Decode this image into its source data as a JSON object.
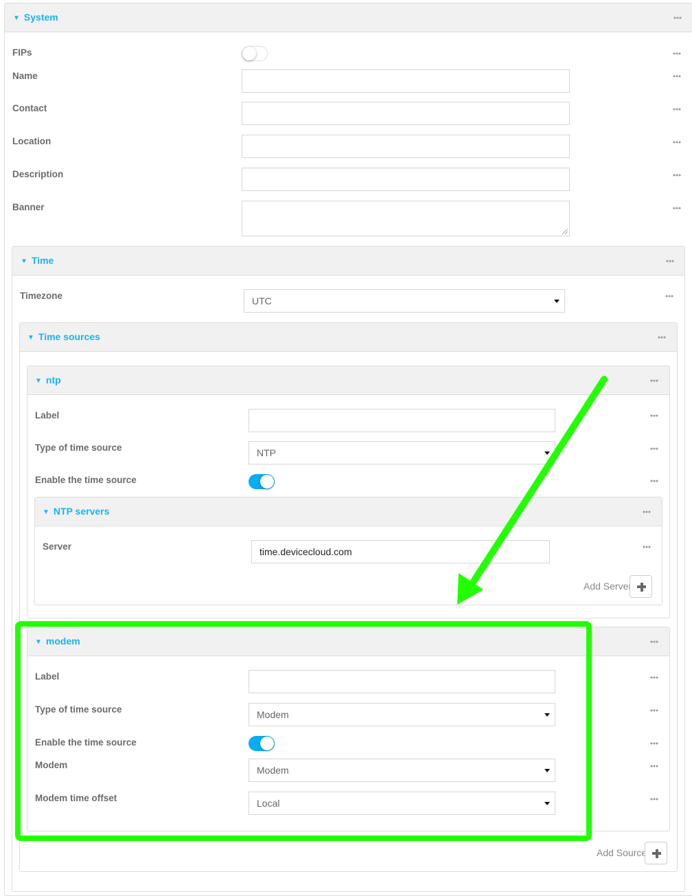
{
  "system": {
    "title": "System",
    "fields": {
      "fips": {
        "label": "FIPs",
        "enabled": false
      },
      "name": {
        "label": "Name",
        "value": ""
      },
      "contact": {
        "label": "Contact",
        "value": ""
      },
      "location": {
        "label": "Location",
        "value": ""
      },
      "description": {
        "label": "Description",
        "value": ""
      },
      "banner": {
        "label": "Banner",
        "value": ""
      }
    },
    "time": {
      "title": "Time",
      "timezone": {
        "label": "Timezone",
        "value": "UTC"
      },
      "time_sources": {
        "title": "Time sources",
        "sources": [
          {
            "title": "ntp",
            "label": {
              "label": "Label",
              "value": ""
            },
            "type": {
              "label": "Type of time source",
              "value": "NTP"
            },
            "enable": {
              "label": "Enable the time source",
              "enabled": true
            },
            "ntp_servers": {
              "title": "NTP servers",
              "server": {
                "label": "Server",
                "value": "time.devicecloud.com"
              },
              "add_label": "Add Server"
            }
          },
          {
            "title": "modem",
            "label": {
              "label": "Label",
              "value": ""
            },
            "type": {
              "label": "Type of time source",
              "value": "Modem"
            },
            "enable": {
              "label": "Enable the time source",
              "enabled": true
            },
            "modem": {
              "label": "Modem",
              "value": "Modem"
            },
            "offset": {
              "label": "Modem time offset",
              "value": "Local"
            }
          }
        ],
        "add_label": "Add Source"
      }
    }
  },
  "icons": {
    "caret": "▾",
    "more": "more-options-icon",
    "add": "plus-icon"
  },
  "colors": {
    "accent": "#19b4ef",
    "toggle_on": "#05aef2",
    "annotation": "#22ff00"
  }
}
